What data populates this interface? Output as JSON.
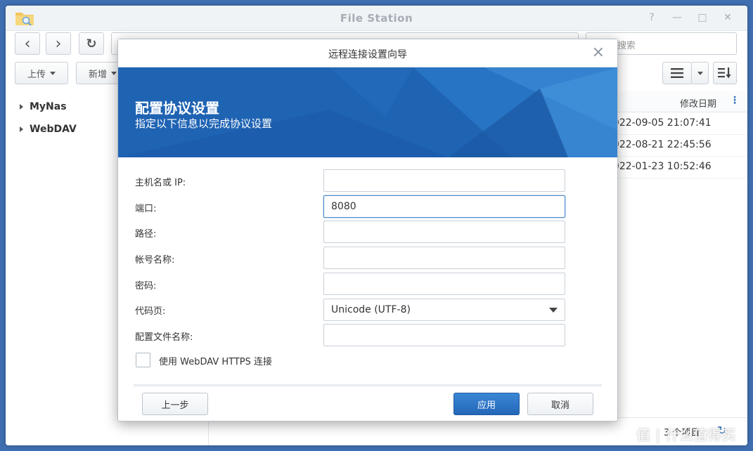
{
  "window": {
    "title": "File Station",
    "controls": {
      "help": "?",
      "minimize": "—",
      "maximize": "□",
      "close": "✕"
    }
  },
  "toolbar": {
    "back": "‹",
    "forward": "›",
    "refresh": "↻",
    "upload_label": "上传",
    "create_label": "新增",
    "search_placeholder": "搜索"
  },
  "sidebar": {
    "items": [
      {
        "label": "MyNas"
      },
      {
        "label": "WebDAV"
      }
    ]
  },
  "file_list": {
    "header_date": "修改日期",
    "header_more": "⋮",
    "rows": [
      {
        "date": "2022-09-05 21:07:41"
      },
      {
        "date": "2022-08-21 22:45:56"
      },
      {
        "date": "2022-01-23 10:52:46"
      }
    ],
    "status_count": "3 个项目"
  },
  "dialog": {
    "title": "远程连接设置向导",
    "banner_title": "配置协议设置",
    "banner_subtitle": "指定以下信息以完成协议设置",
    "fields": [
      {
        "label": "主机名或 IP:",
        "value": ""
      },
      {
        "label": "端口:",
        "value": "8080"
      },
      {
        "label": "路径:",
        "value": ""
      },
      {
        "label": "帐号名称:",
        "value": ""
      },
      {
        "label": "密码:",
        "value": ""
      },
      {
        "label": "代码页:",
        "value": "Unicode (UTF-8)"
      },
      {
        "label": "配置文件名称:",
        "value": ""
      }
    ],
    "checkbox_label": "使用 WebDAV HTTPS 连接",
    "buttons": {
      "prev": "上一步",
      "apply": "应用",
      "cancel": "取消"
    }
  },
  "watermark": "值 | 什么值得买",
  "colors": {
    "accent": "#2467b8",
    "banner": "#1f64b4",
    "desktop": "#3f6fb0"
  }
}
